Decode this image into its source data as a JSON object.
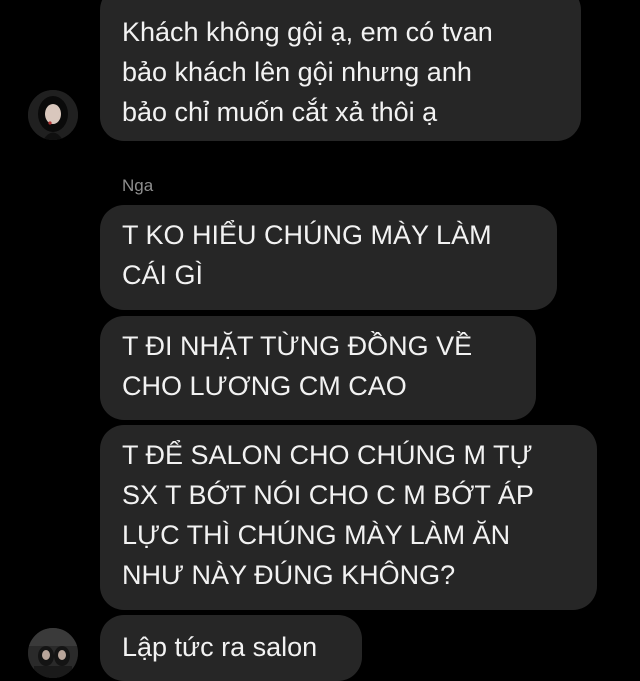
{
  "conversation": {
    "messages": [
      {
        "text": "Khách không gội ạ, em có tvan\nbảo khách lên gội nhưng anh\nbảo chỉ muốn cắt xả thôi ạ"
      },
      {
        "text": "T KO HIỂU CHÚNG MÀY LÀM\nCÁI GÌ"
      },
      {
        "text": "T ĐI NHẶT TỪNG ĐỒNG VỀ\nCHO LƯƠNG CM CAO"
      },
      {
        "text": "T ĐỂ SALON CHO CHÚNG M TỰ\nSX T BỚT NÓI CHO C M BỚT ÁP\nLỰC THÌ CHÚNG MÀY LÀM ĂN\nNHƯ NÀY ĐÚNG KHÔNG?"
      },
      {
        "text": "Lập tức ra salon"
      }
    ],
    "sender_name": "Nga"
  },
  "colors": {
    "background": "#000000",
    "bubble": "#262626",
    "text": "#f2f2f2",
    "sender_name": "#8e8e8e"
  }
}
